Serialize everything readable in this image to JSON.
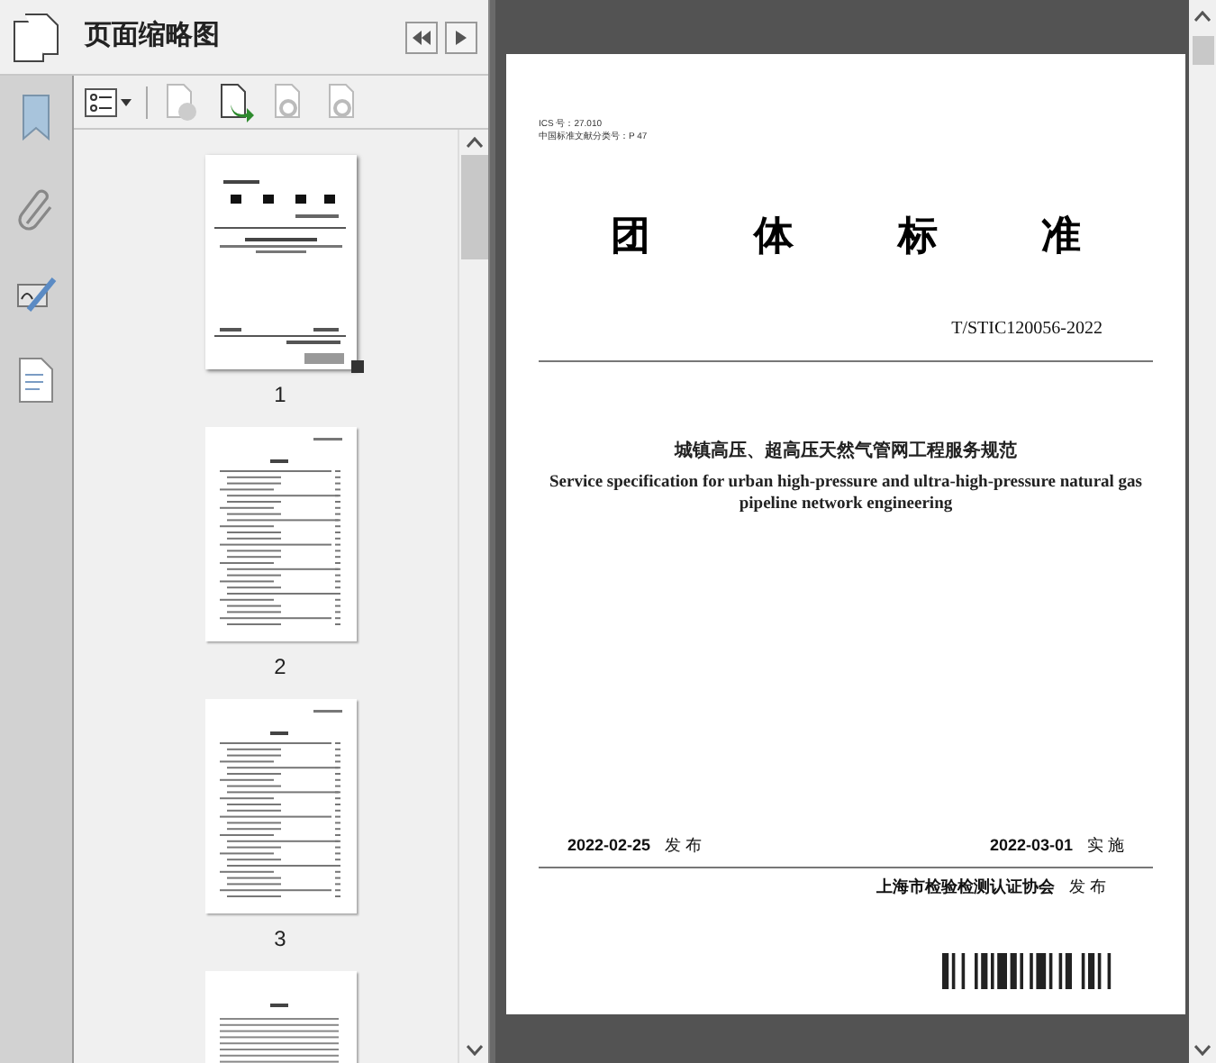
{
  "panel": {
    "title": "页面缩略图"
  },
  "thumbnails": [
    {
      "label": "1",
      "selected": true,
      "kind": "cover"
    },
    {
      "label": "2",
      "selected": false,
      "kind": "toc"
    },
    {
      "label": "3",
      "selected": false,
      "kind": "toc"
    },
    {
      "kind": "text",
      "selected": false
    }
  ],
  "document": {
    "meta": [
      "ICS 号：27.010",
      "中国标准文献分类号：P 47"
    ],
    "heading": [
      "团",
      "体",
      "标",
      "准"
    ],
    "code": "T/STIC120056-2022",
    "title_cn": "城镇高压、超高压天然气管网工程服务规范",
    "title_en": "Service specification for urban high-pressure and ultra-high-pressure natural gas pipeline network engineering",
    "issue_date": "2022-02-25",
    "issue_label": "发 布",
    "effective_date": "2022-03-01",
    "effective_label": "实 施",
    "publisher": "上海市检验检测认证协会",
    "publisher_label": "发 布"
  }
}
